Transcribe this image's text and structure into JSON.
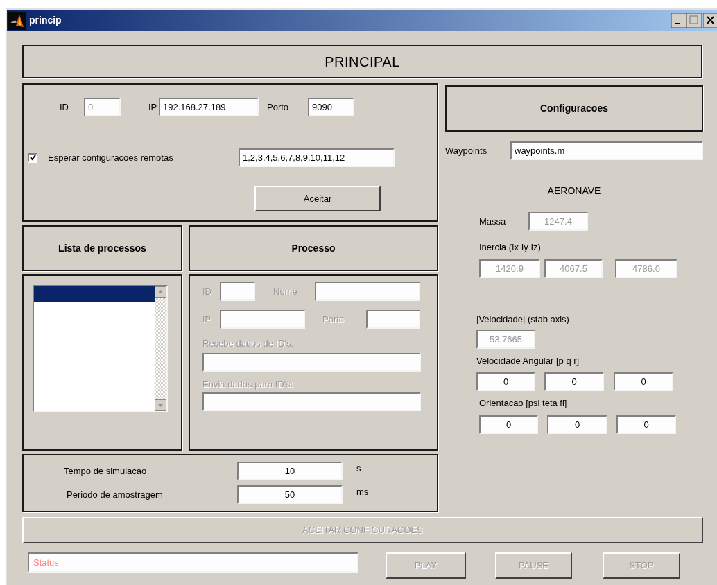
{
  "window": {
    "title": "princip"
  },
  "header": {
    "title": "PRINCIPAL"
  },
  "connection": {
    "id": {
      "label": "ID",
      "value": "0",
      "disabled": true
    },
    "ip": {
      "label": "IP",
      "value": "192.168.27.189"
    },
    "port": {
      "label": "Porto",
      "value": "9090"
    },
    "remote": {
      "label": "Esperar configuracoes remotas",
      "checked": true,
      "value": "1,2,3,4,5,6,7,8,9,10,11,12"
    },
    "accept_button": "Aceitar"
  },
  "process_list": {
    "title": "Lista de processos",
    "rows": [
      {
        "selected": true
      }
    ]
  },
  "process": {
    "title": "Processo",
    "disabled": true,
    "id_label": "ID",
    "name_label": "Nome",
    "ip_label": "IP",
    "port_label": "Porto",
    "receives_label": "Recebe dados de ID's:",
    "sends_label": "Envia dados para ID's:"
  },
  "simulation": [
    {
      "label": "Tempo de simulacao",
      "value": "10",
      "unit": "s"
    },
    {
      "label": "Periodo de amostragem",
      "value": "50",
      "unit": "ms"
    }
  ],
  "config": {
    "title": "Configuracoes",
    "waypoints": {
      "label": "Waypoints",
      "value": "waypoints.m"
    },
    "aircraft_title": "AERONAVE",
    "mass": {
      "label": "Massa",
      "value": "1247.4",
      "disabled": true
    },
    "inertia": {
      "label": "Inercia (Ix Iy Iz)",
      "values": [
        "1420.9",
        "4067.5",
        "4786.0"
      ],
      "disabled": true
    },
    "speed": {
      "label": "|Velocidade| (stab axis)",
      "value": "53.7665",
      "disabled": true
    },
    "angular": {
      "label": "Velocidade Angular [p q r]",
      "values": [
        "0",
        "0",
        "0"
      ]
    },
    "orientation": {
      "label": "Orientacao [psi teta fi]",
      "values": [
        "0",
        "0",
        "0"
      ]
    }
  },
  "accept_all_button": {
    "label": "ACEITAR CONFIGURACOES",
    "disabled": true
  },
  "status": {
    "value": "Status"
  },
  "buttons": [
    {
      "label": "PLAY",
      "disabled": true
    },
    {
      "label": "PAUSE",
      "disabled": true
    },
    {
      "label": "STOP",
      "disabled": true
    }
  ]
}
